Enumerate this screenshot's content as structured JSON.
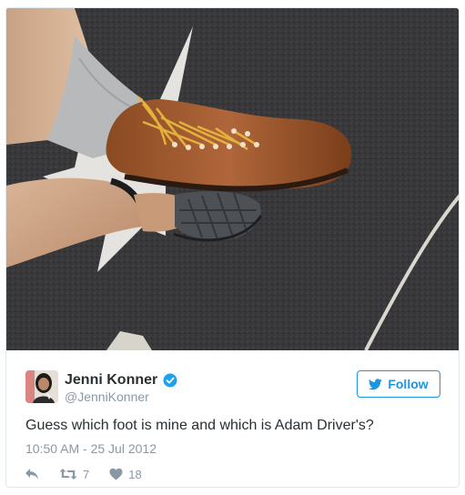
{
  "tweet": {
    "author_name": "Jenni Konner",
    "author_handle": "@JenniKonner",
    "verified": true,
    "follow_label": "Follow",
    "text": "Guess which foot is mine and which is Adam Driver's?",
    "timestamp": "10:50 AM - 25 Jul 2012",
    "retweet_count": "7",
    "like_count": "18"
  },
  "colors": {
    "accent": "#1b95e0",
    "text": "#292f33",
    "muted": "#8899a6",
    "verified": "#1da1f2"
  },
  "icons": [
    "twitter-bird-icon",
    "verified-badge-icon",
    "reply-icon",
    "retweet-icon",
    "heart-icon"
  ]
}
